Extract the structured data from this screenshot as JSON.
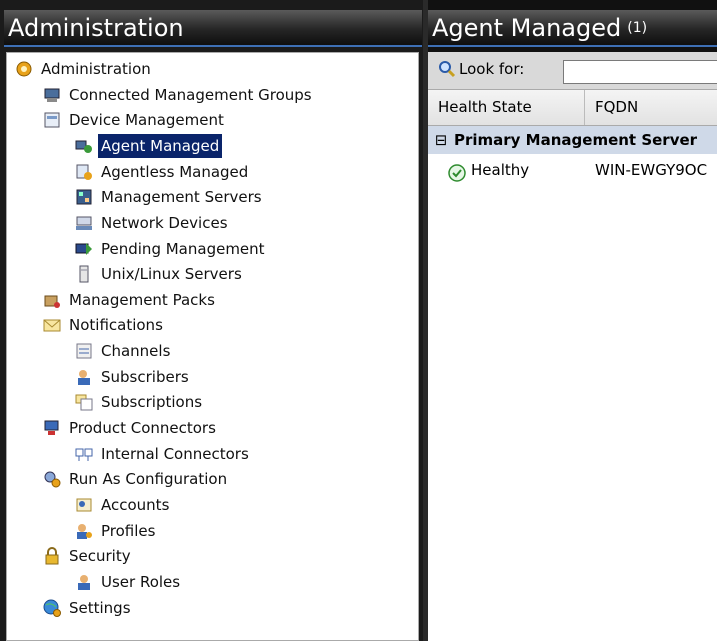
{
  "left_pane": {
    "title": "Administration",
    "tree": [
      {
        "label": "Administration",
        "icon": "gear-icon"
      },
      {
        "label": "Connected Management Groups",
        "icon": "connected-groups-icon"
      },
      {
        "label": "Device Management",
        "icon": "device-management-icon"
      },
      {
        "label": "Agent Managed",
        "icon": "agent-managed-icon",
        "selected": true
      },
      {
        "label": "Agentless Managed",
        "icon": "agentless-managed-icon"
      },
      {
        "label": "Management Servers",
        "icon": "management-servers-icon"
      },
      {
        "label": "Network Devices",
        "icon": "network-devices-icon"
      },
      {
        "label": "Pending Management",
        "icon": "pending-management-icon"
      },
      {
        "label": "Unix/Linux Servers",
        "icon": "unix-linux-servers-icon"
      },
      {
        "label": "Management Packs",
        "icon": "management-packs-icon"
      },
      {
        "label": "Notifications",
        "icon": "envelope-icon"
      },
      {
        "label": "Channels",
        "icon": "channels-icon"
      },
      {
        "label": "Subscribers",
        "icon": "subscribers-icon"
      },
      {
        "label": "Subscriptions",
        "icon": "subscriptions-icon"
      },
      {
        "label": "Product Connectors",
        "icon": "product-connectors-icon"
      },
      {
        "label": "Internal Connectors",
        "icon": "internal-connectors-icon"
      },
      {
        "label": "Run As Configuration",
        "icon": "run-as-configuration-icon"
      },
      {
        "label": "Accounts",
        "icon": "accounts-icon"
      },
      {
        "label": "Profiles",
        "icon": "profiles-icon"
      },
      {
        "label": "Security",
        "icon": "lock-icon"
      },
      {
        "label": "User Roles",
        "icon": "user-roles-icon"
      },
      {
        "label": "Settings",
        "icon": "settings-globe-icon"
      }
    ]
  },
  "right_pane": {
    "title": "Agent Managed",
    "count": "(1)",
    "search": {
      "label": "Look for:",
      "value": "",
      "icon": "magnifier-icon"
    },
    "columns": [
      "Health State",
      "FQDN"
    ],
    "group": {
      "expander": "⊟",
      "label": "Primary Management Server"
    },
    "rows": [
      {
        "health": "Healthy",
        "health_icon": "healthy-check-icon",
        "fqdn": "WIN-EWGY9OC"
      }
    ]
  },
  "colors": {
    "selection": "#0a246a",
    "header_accent": "#3d6fb5",
    "healthy": "#2e8b2e"
  }
}
